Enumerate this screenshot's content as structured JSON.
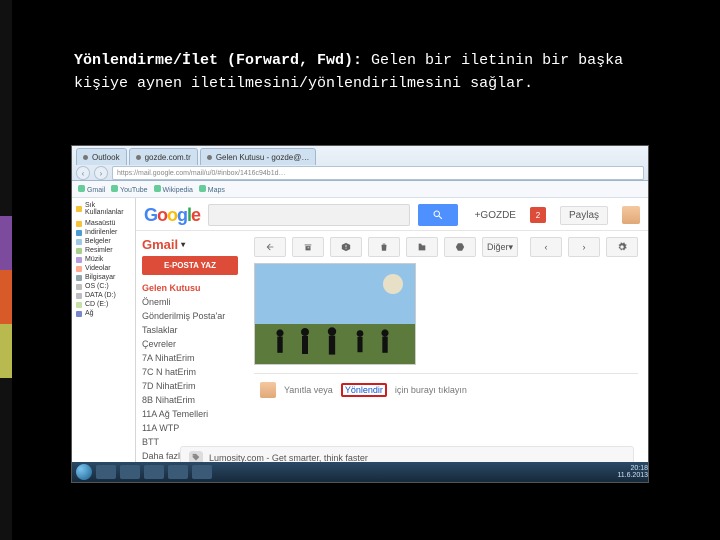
{
  "slide": {
    "title_bold": "Yönlendirme/İlet (Forward, Fwd):",
    "rest": " Gelen bir iletinin bir başka kişiye aynen iletilmesini/yönlendirilmesini sağlar."
  },
  "browser": {
    "tabs": [
      {
        "label": "Outlook"
      },
      {
        "label": "gozde.com.tr"
      },
      {
        "label": "Gelen Kutusu - gozde@…"
      }
    ],
    "url": "https://mail.google.com/mail/u/0/#inbox/1416c94b1d…",
    "bookmarks": [
      "Gmail",
      "YouTube",
      "Wikipedia",
      "Maps"
    ]
  },
  "win_panel": {
    "title": "Sık Kullanılanlar",
    "items": [
      "Masaüstü",
      "İndirilenler",
      "Belgeler",
      "Resimler",
      "Müzik",
      "Videolar",
      "Bilgisayar",
      "OS (C:)",
      "DATA (D:)",
      "CD (E:)",
      "Ağ"
    ],
    "colors": [
      "#f6c338",
      "#4b9cd3",
      "#9ec9e2",
      "#a8d08d",
      "#b39ddb",
      "#ffab91",
      "#90a4ae",
      "#bdbdbd",
      "#bdbdbd",
      "#c5e1a5",
      "#7986cb"
    ]
  },
  "gmail": {
    "logo_letters": [
      "G",
      "o",
      "o",
      "g",
      "l",
      "e"
    ],
    "brand": "Gmail",
    "compose": "E-POSTA YAZ",
    "labels": [
      "Gelen Kutusu",
      "Önemli",
      "Gönderilmiş Posta'ar",
      "Taslaklar",
      "Çevreler",
      "7A NihatErim",
      "7C N hatErim",
      "7D NihatErim",
      "8B NihatErim",
      "11A Ağ Temelleri",
      "11A WTP",
      "BTT",
      "Daha fazla ▾"
    ],
    "selected_index": 0,
    "plus_user": "+GOZDE",
    "share": "Paylaş",
    "notif_count": "2",
    "toolbar_more": "Diğer",
    "reply_avatar": true,
    "reply_prefix": "Yanıtla veya",
    "reply_highlight": "Yönlendir",
    "reply_suffix": "için burayı tıklayın"
  },
  "ad": {
    "text": "Lumosity.com - Get smarter, think faster"
  },
  "taskbar": {
    "time": "20:18",
    "date": "11.6.2013"
  }
}
